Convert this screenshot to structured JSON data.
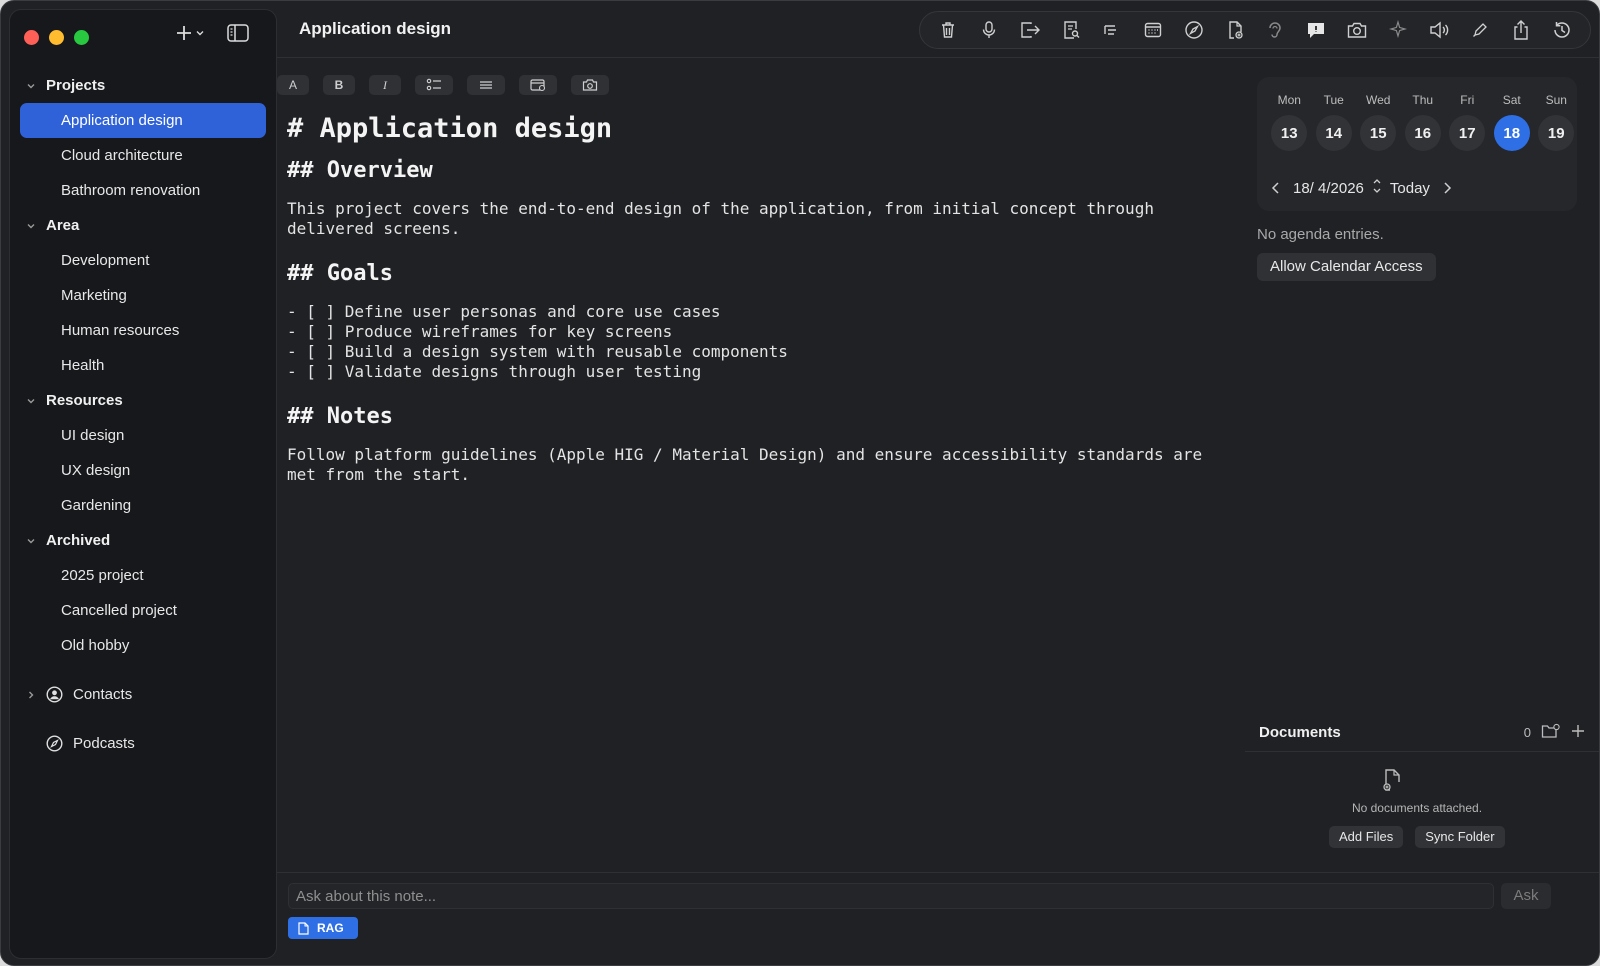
{
  "window": {
    "title": "Application design"
  },
  "sidebar": {
    "groups": [
      {
        "title": "Projects",
        "items": [
          "Application design",
          "Cloud architecture",
          "Bathroom renovation"
        ]
      },
      {
        "title": "Area",
        "items": [
          "Development",
          "Marketing",
          "Human resources",
          "Health"
        ]
      },
      {
        "title": "Resources",
        "items": [
          "UI design",
          "UX design",
          "Gardening"
        ]
      },
      {
        "title": "Archived",
        "items": [
          "2025 project",
          "Cancelled project",
          "Old hobby"
        ]
      }
    ],
    "selected": "Application design",
    "contacts_label": "Contacts",
    "podcasts_label": "Podcasts"
  },
  "toolbar_icons": [
    "trash-icon",
    "microphone-icon",
    "export-icon",
    "document-search-icon",
    "outline-icon",
    "calendar-icon",
    "compass-icon",
    "add-document-icon",
    "ear-icon",
    "chat-icon",
    "camera-icon",
    "sparkles-icon",
    "speaker-icon",
    "pen-icon",
    "share-icon",
    "history-icon"
  ],
  "format_bar": {
    "text": "A",
    "bold": "B",
    "italic": "I"
  },
  "editor": {
    "h1": "# Application design",
    "overview_h": "## Overview",
    "overview_p": "This project covers the end-to-end design of the application, from initial concept through delivered screens.",
    "goals_h": "## Goals",
    "goals": [
      "- [ ] Define user personas and core use cases",
      "- [ ] Produce wireframes for key screens",
      "- [ ] Build a design system with reusable components",
      "- [ ] Validate designs through user testing"
    ],
    "notes_h": "## Notes",
    "notes_p": "Follow platform guidelines (Apple HIG / Material Design) and ensure accessibility standards are met from the start."
  },
  "calendar": {
    "days": [
      {
        "name": "Mon",
        "date": "13"
      },
      {
        "name": "Tue",
        "date": "14"
      },
      {
        "name": "Wed",
        "date": "15"
      },
      {
        "name": "Thu",
        "date": "16"
      },
      {
        "name": "Fri",
        "date": "17"
      },
      {
        "name": "Sat",
        "date": "18"
      },
      {
        "name": "Sun",
        "date": "19"
      }
    ],
    "selected_date": "18",
    "date_field": "18/ 4/2026",
    "today_label": "Today",
    "no_agenda": "No agenda entries.",
    "allow_access": "Allow Calendar Access"
  },
  "documents": {
    "title": "Documents",
    "count": "0",
    "empty": "No documents attached.",
    "add_files": "Add Files",
    "sync_folder": "Sync Folder"
  },
  "ask": {
    "placeholder": "Ask about this note...",
    "button": "Ask",
    "rag": "RAG"
  },
  "colors": {
    "accent": "#2f6fe6",
    "selected": "#2f62d9",
    "background": "#1f2124",
    "sidebar": "#16181b"
  }
}
